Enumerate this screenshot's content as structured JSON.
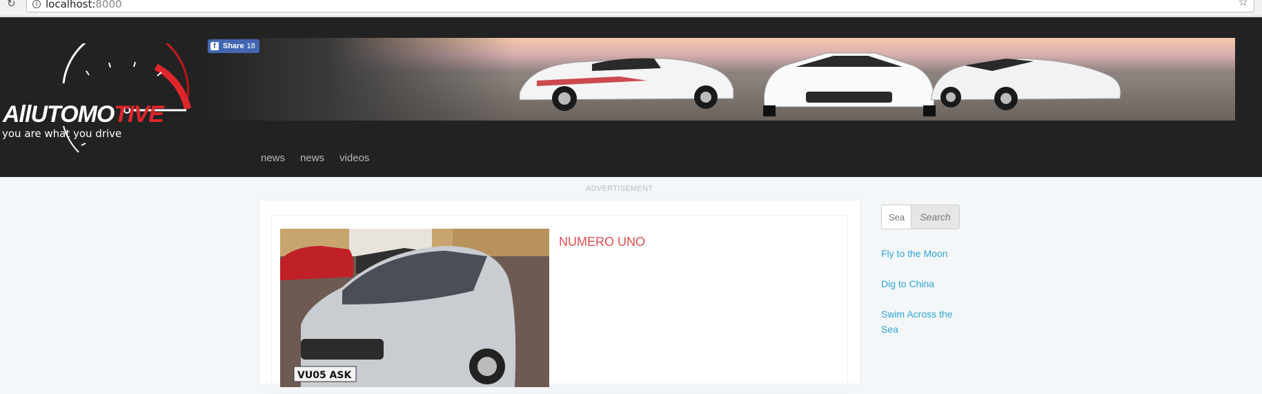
{
  "browser": {
    "url_host": "localhost:",
    "url_port": "8000"
  },
  "header": {
    "logo_text_white": "AllUTOMO",
    "logo_text_red": "TIVE",
    "logo_tagline": "you are what you drive",
    "share": {
      "label": "Share",
      "count": "18"
    },
    "nav": [
      {
        "label": "news"
      },
      {
        "label": "news"
      },
      {
        "label": "videos"
      }
    ]
  },
  "content": {
    "advertisement_label": "ADVERTISEMENT",
    "post_title": "NUMERO UNO"
  },
  "sidebar": {
    "search_placeholder": "Sea",
    "search_button": "Search",
    "links": [
      {
        "label": "Fly to the Moon"
      },
      {
        "label": "Dig to China"
      },
      {
        "label": "Swim Across the Sea"
      }
    ]
  },
  "colors": {
    "header_bg": "#222222",
    "accent_red": "#e0262b",
    "link_blue": "#2fa4d5",
    "title_red": "#e04d4f"
  }
}
